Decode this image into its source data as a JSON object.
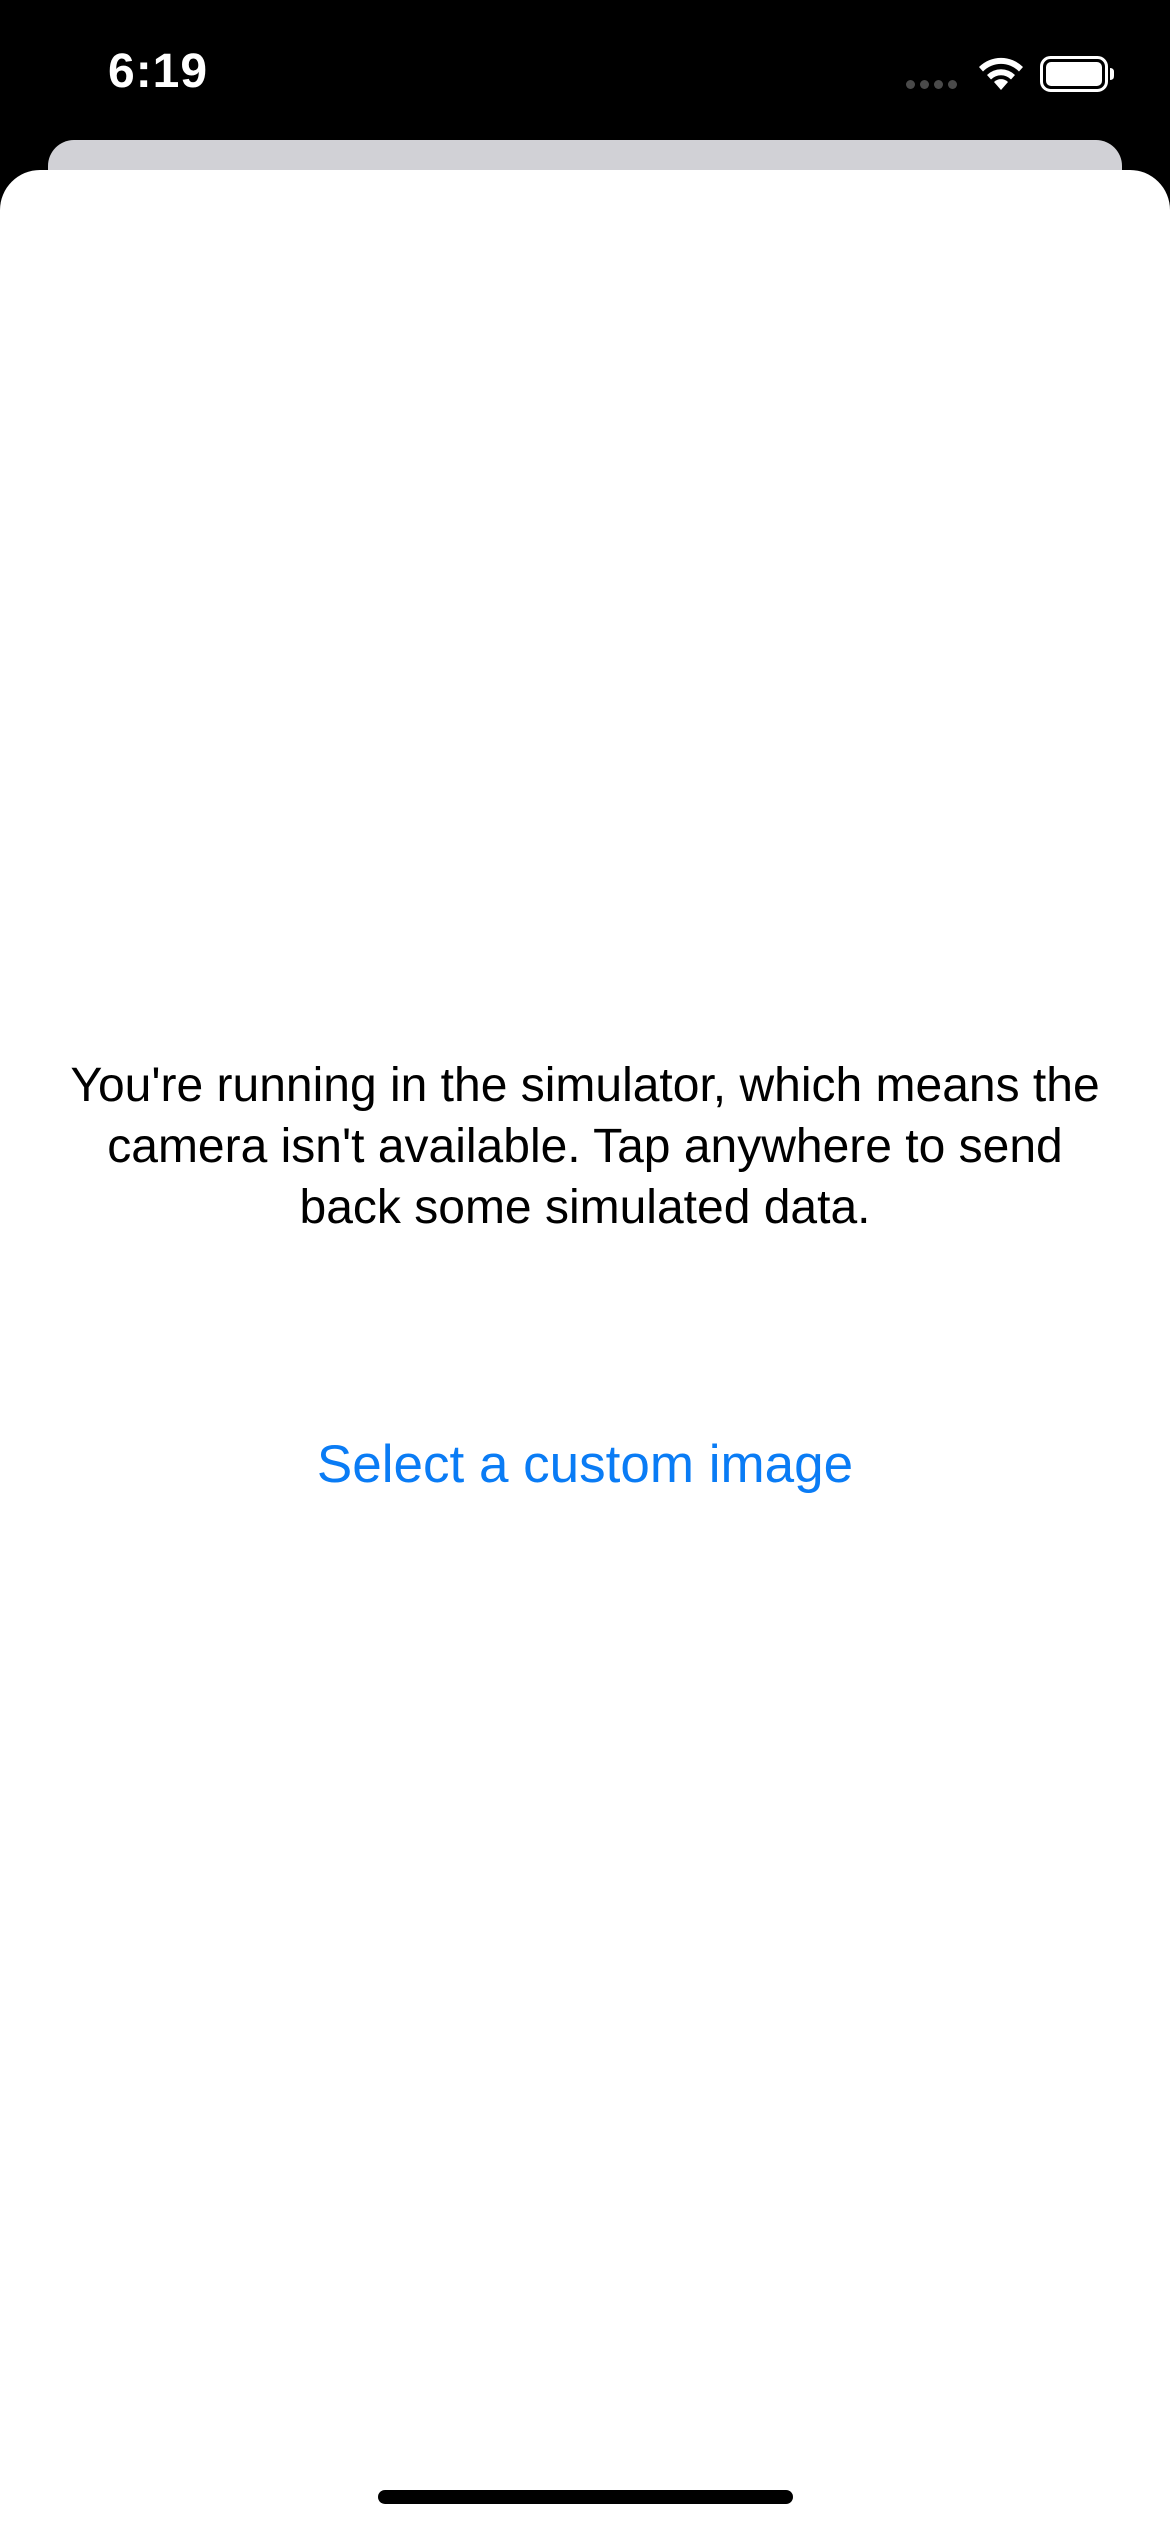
{
  "status_bar": {
    "time": "6:19"
  },
  "message": {
    "text": "You're running in the simulator, which means the camera isn't available. Tap anywhere to send back some simulated data."
  },
  "actions": {
    "select_custom_image": "Select a custom image"
  },
  "colors": {
    "status_bar_background": "#000000",
    "sheet_background": "#ffffff",
    "back_sheet": "#d1d1d6",
    "link_blue": "#0a7cf5",
    "text": "#000000"
  },
  "icons": {
    "signal": "cellular-signal-icon",
    "wifi": "wifi-icon",
    "battery": "battery-icon"
  }
}
